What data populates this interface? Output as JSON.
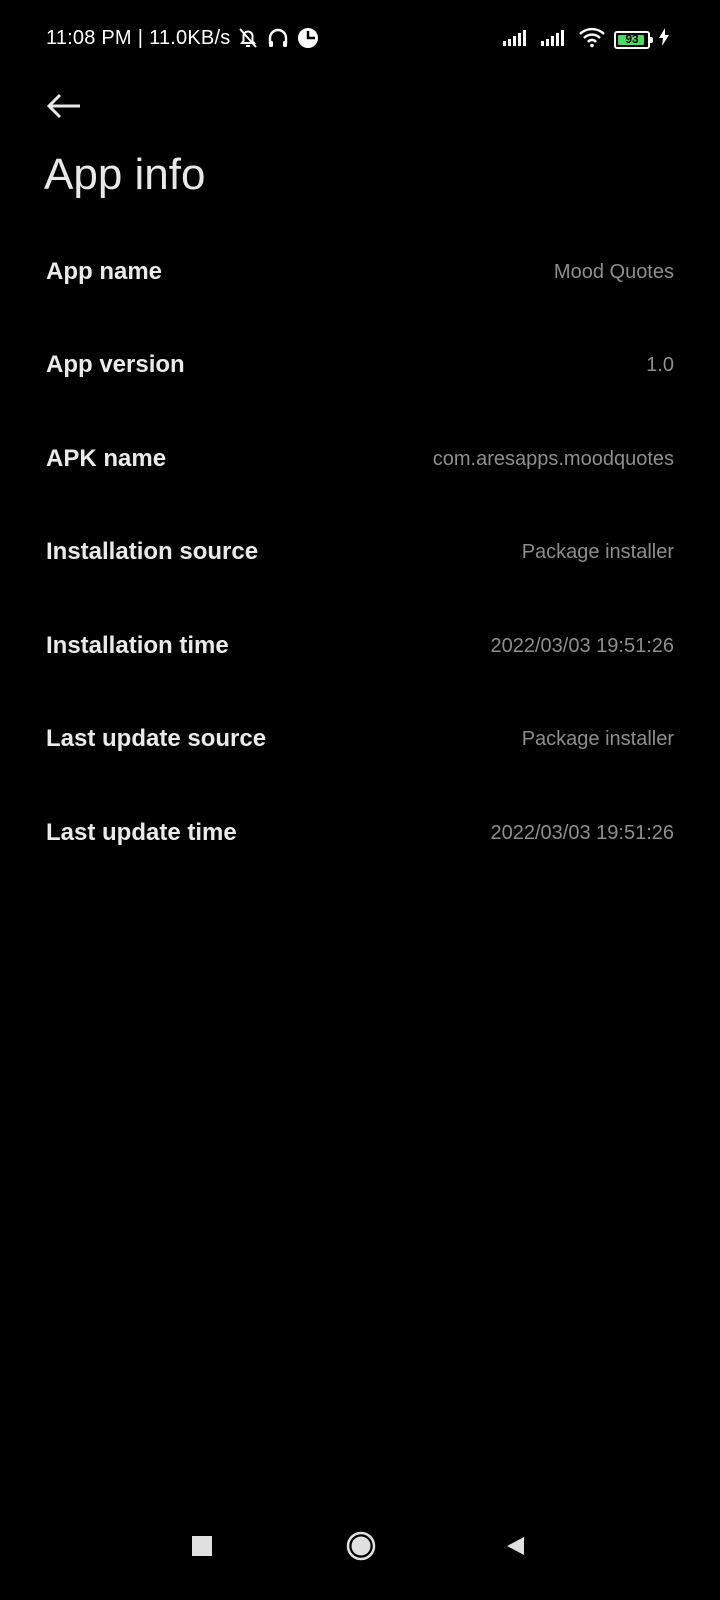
{
  "status_bar": {
    "time": "11:08 PM",
    "separator": "|",
    "network_speed": "11.0KB/s",
    "battery_level": "93",
    "icons": [
      "bell-off-icon",
      "headphones-icon",
      "app-notification-icon",
      "signal-icon",
      "signal-icon",
      "wifi-icon",
      "battery-icon",
      "charging-icon"
    ]
  },
  "header": {
    "back_icon": "arrow-left-icon",
    "title": "App info"
  },
  "info": [
    {
      "label": "App name",
      "value": "Mood Quotes"
    },
    {
      "label": "App version",
      "value": "1.0"
    },
    {
      "label": "APK name",
      "value": "com.aresapps.moodquotes"
    },
    {
      "label": "Installation source",
      "value": "Package installer"
    },
    {
      "label": "Installation time",
      "value": "2022/03/03 19:51:26"
    },
    {
      "label": "Last update source",
      "value": "Package installer"
    },
    {
      "label": "Last update time",
      "value": "2022/03/03 19:51:26"
    }
  ],
  "nav_bar": {
    "recents_icon": "square-icon",
    "home_icon": "circle-icon",
    "back_icon": "triangle-back-icon"
  },
  "colors": {
    "background": "#000000",
    "label": "#eaeaea",
    "value": "#8e8e8e",
    "battery_fill": "#4cd964"
  }
}
